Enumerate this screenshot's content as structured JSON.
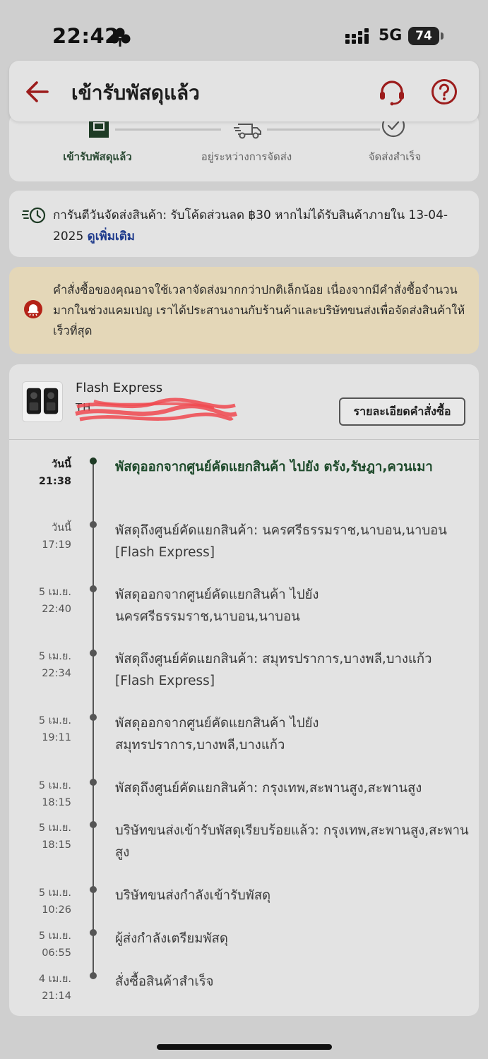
{
  "status_bar": {
    "time": "22:42",
    "network": "5G",
    "battery": "74"
  },
  "header": {
    "title": "เข้ารับพัสดุแล้ว",
    "accent_color": "#9c1c1c"
  },
  "progress": {
    "steps": [
      {
        "label": "เข้ารับพัสดุแล้ว",
        "icon": "package-icon",
        "active": true
      },
      {
        "label": "อยู่ระหว่างการจัดส่ง",
        "icon": "delivery-truck-icon",
        "active": false
      },
      {
        "label": "จัดส่งสำเร็จ",
        "icon": "check-circle-icon",
        "active": false
      }
    ]
  },
  "guarantee": {
    "text": "การันตีวันจัดส่งสินค้า: รับโค้ดส่วนลด ฿30 หากไม่ได้รับสินค้าภายใน 13-04-2025",
    "link": "ดูเพิ่มเติม"
  },
  "notice": {
    "text": "คำสั่งซื้อของคุณอาจใช้เวลาจัดส่งมากกว่าปกติเล็กน้อย เนื่องจากมีคำสั่งซื้อจำนวนมากในช่วงแคมเปญ เราได้ประสานงานกับร้านค้าและบริษัทขนส่งเพื่อจัดส่งสินค้าให้เร็วที่สุด",
    "background": "#e4d7b8"
  },
  "shipment": {
    "carrier": "Flash Express",
    "tracking_number": "TH",
    "order_details_button": "รายละเอียดคำสั่งซื้อ",
    "events": [
      {
        "date": "วันนี้",
        "time": "21:38",
        "text": "พัสดุออกจากศูนย์คัดแยกสินค้า ไปยัง ตรัง,รัษฎา,ควนเมา",
        "active": true
      },
      {
        "date": "วันนี้",
        "time": "17:19",
        "text": "พัสดุถึงศูนย์คัดแยกสินค้า: นครศรีธรรมราช,นาบอน,นาบอน  [Flash Express]",
        "active": false
      },
      {
        "date": "5 เม.ย.",
        "time": "22:40",
        "text": "พัสดุออกจากศูนย์คัดแยกสินค้า ไปยัง นครศรีธรรมราช,นาบอน,นาบอน",
        "active": false
      },
      {
        "date": "5 เม.ย.",
        "time": "22:34",
        "text": "พัสดุถึงศูนย์คัดแยกสินค้า: สมุทรปราการ,บางพลี,บางแก้ว  [Flash Express]",
        "active": false
      },
      {
        "date": "5 เม.ย.",
        "time": "19:11",
        "text": "พัสดุออกจากศูนย์คัดแยกสินค้า ไปยัง สมุทรปราการ,บางพลี,บางแก้ว",
        "active": false
      },
      {
        "date": "5 เม.ย.",
        "time": "18:15",
        "text": "พัสดุถึงศูนย์คัดแยกสินค้า: กรุงเทพ,สะพานสูง,สะพานสูง",
        "active": false
      },
      {
        "date": "5 เม.ย.",
        "time": "18:15",
        "text": "บริษัทขนส่งเข้ารับพัสดุเรียบร้อยแล้ว: กรุงเทพ,สะพานสูง,สะพานสูง",
        "active": false
      },
      {
        "date": "5 เม.ย.",
        "time": "10:26",
        "text": "บริษัทขนส่งกำลังเข้ารับพัสดุ",
        "active": false
      },
      {
        "date": "5 เม.ย.",
        "time": "06:55",
        "text": " ผู้ส่งกำลังเตรียมพัสดุ",
        "active": false
      },
      {
        "date": "4 เม.ย.",
        "time": "21:14",
        "text": "สั่งซื้อสินค้าสำเร็จ",
        "active": false
      }
    ]
  }
}
